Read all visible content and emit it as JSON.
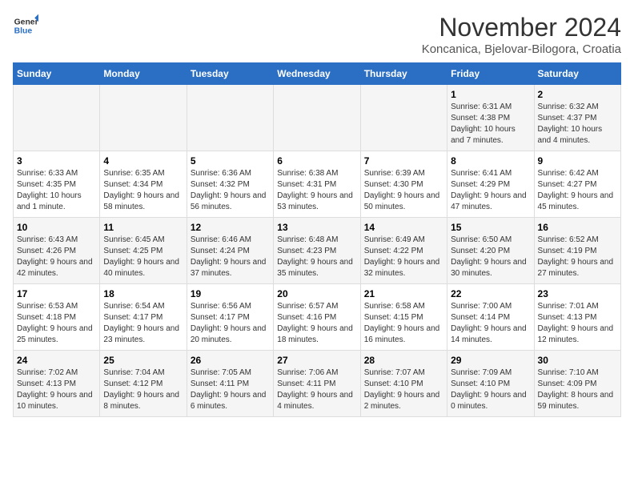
{
  "header": {
    "logo_line1": "General",
    "logo_line2": "Blue",
    "month_title": "November 2024",
    "location": "Koncanica, Bjelovar-Bilogora, Croatia"
  },
  "weekdays": [
    "Sunday",
    "Monday",
    "Tuesday",
    "Wednesday",
    "Thursday",
    "Friday",
    "Saturday"
  ],
  "weeks": [
    [
      {
        "day": "",
        "info": ""
      },
      {
        "day": "",
        "info": ""
      },
      {
        "day": "",
        "info": ""
      },
      {
        "day": "",
        "info": ""
      },
      {
        "day": "",
        "info": ""
      },
      {
        "day": "1",
        "info": "Sunrise: 6:31 AM\nSunset: 4:38 PM\nDaylight: 10 hours and 7 minutes."
      },
      {
        "day": "2",
        "info": "Sunrise: 6:32 AM\nSunset: 4:37 PM\nDaylight: 10 hours and 4 minutes."
      }
    ],
    [
      {
        "day": "3",
        "info": "Sunrise: 6:33 AM\nSunset: 4:35 PM\nDaylight: 10 hours and 1 minute."
      },
      {
        "day": "4",
        "info": "Sunrise: 6:35 AM\nSunset: 4:34 PM\nDaylight: 9 hours and 58 minutes."
      },
      {
        "day": "5",
        "info": "Sunrise: 6:36 AM\nSunset: 4:32 PM\nDaylight: 9 hours and 56 minutes."
      },
      {
        "day": "6",
        "info": "Sunrise: 6:38 AM\nSunset: 4:31 PM\nDaylight: 9 hours and 53 minutes."
      },
      {
        "day": "7",
        "info": "Sunrise: 6:39 AM\nSunset: 4:30 PM\nDaylight: 9 hours and 50 minutes."
      },
      {
        "day": "8",
        "info": "Sunrise: 6:41 AM\nSunset: 4:29 PM\nDaylight: 9 hours and 47 minutes."
      },
      {
        "day": "9",
        "info": "Sunrise: 6:42 AM\nSunset: 4:27 PM\nDaylight: 9 hours and 45 minutes."
      }
    ],
    [
      {
        "day": "10",
        "info": "Sunrise: 6:43 AM\nSunset: 4:26 PM\nDaylight: 9 hours and 42 minutes."
      },
      {
        "day": "11",
        "info": "Sunrise: 6:45 AM\nSunset: 4:25 PM\nDaylight: 9 hours and 40 minutes."
      },
      {
        "day": "12",
        "info": "Sunrise: 6:46 AM\nSunset: 4:24 PM\nDaylight: 9 hours and 37 minutes."
      },
      {
        "day": "13",
        "info": "Sunrise: 6:48 AM\nSunset: 4:23 PM\nDaylight: 9 hours and 35 minutes."
      },
      {
        "day": "14",
        "info": "Sunrise: 6:49 AM\nSunset: 4:22 PM\nDaylight: 9 hours and 32 minutes."
      },
      {
        "day": "15",
        "info": "Sunrise: 6:50 AM\nSunset: 4:20 PM\nDaylight: 9 hours and 30 minutes."
      },
      {
        "day": "16",
        "info": "Sunrise: 6:52 AM\nSunset: 4:19 PM\nDaylight: 9 hours and 27 minutes."
      }
    ],
    [
      {
        "day": "17",
        "info": "Sunrise: 6:53 AM\nSunset: 4:18 PM\nDaylight: 9 hours and 25 minutes."
      },
      {
        "day": "18",
        "info": "Sunrise: 6:54 AM\nSunset: 4:17 PM\nDaylight: 9 hours and 23 minutes."
      },
      {
        "day": "19",
        "info": "Sunrise: 6:56 AM\nSunset: 4:17 PM\nDaylight: 9 hours and 20 minutes."
      },
      {
        "day": "20",
        "info": "Sunrise: 6:57 AM\nSunset: 4:16 PM\nDaylight: 9 hours and 18 minutes."
      },
      {
        "day": "21",
        "info": "Sunrise: 6:58 AM\nSunset: 4:15 PM\nDaylight: 9 hours and 16 minutes."
      },
      {
        "day": "22",
        "info": "Sunrise: 7:00 AM\nSunset: 4:14 PM\nDaylight: 9 hours and 14 minutes."
      },
      {
        "day": "23",
        "info": "Sunrise: 7:01 AM\nSunset: 4:13 PM\nDaylight: 9 hours and 12 minutes."
      }
    ],
    [
      {
        "day": "24",
        "info": "Sunrise: 7:02 AM\nSunset: 4:13 PM\nDaylight: 9 hours and 10 minutes."
      },
      {
        "day": "25",
        "info": "Sunrise: 7:04 AM\nSunset: 4:12 PM\nDaylight: 9 hours and 8 minutes."
      },
      {
        "day": "26",
        "info": "Sunrise: 7:05 AM\nSunset: 4:11 PM\nDaylight: 9 hours and 6 minutes."
      },
      {
        "day": "27",
        "info": "Sunrise: 7:06 AM\nSunset: 4:11 PM\nDaylight: 9 hours and 4 minutes."
      },
      {
        "day": "28",
        "info": "Sunrise: 7:07 AM\nSunset: 4:10 PM\nDaylight: 9 hours and 2 minutes."
      },
      {
        "day": "29",
        "info": "Sunrise: 7:09 AM\nSunset: 4:10 PM\nDaylight: 9 hours and 0 minutes."
      },
      {
        "day": "30",
        "info": "Sunrise: 7:10 AM\nSunset: 4:09 PM\nDaylight: 8 hours and 59 minutes."
      }
    ]
  ]
}
